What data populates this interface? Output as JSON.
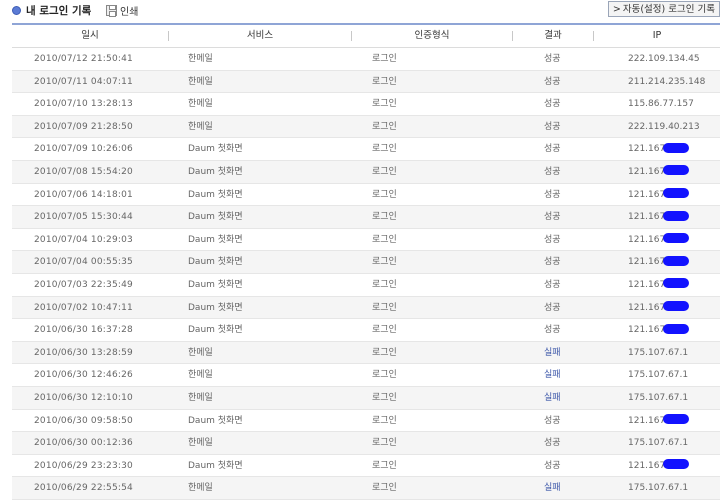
{
  "page": {
    "title": "내 로그인 기록",
    "print_label": "인쇄",
    "auto_login_label": "자동(설정) 로그인 기록"
  },
  "table": {
    "columns": [
      "일시",
      "서비스",
      "인증형식",
      "결과",
      "IP"
    ],
    "rows": [
      {
        "date": "2010/07/12 21:50:41",
        "service": "한메일",
        "auth": "로그인",
        "result": "성공",
        "ip": "222.109.134.45",
        "masked": false
      },
      {
        "date": "2010/07/11 04:07:11",
        "service": "한메일",
        "auth": "로그인",
        "result": "성공",
        "ip": "211.214.235.148",
        "masked": false
      },
      {
        "date": "2010/07/10 13:28:13",
        "service": "한메일",
        "auth": "로그인",
        "result": "성공",
        "ip": "115.86.77.157",
        "masked": false
      },
      {
        "date": "2010/07/09 21:28:50",
        "service": "한메일",
        "auth": "로그인",
        "result": "성공",
        "ip": "222.119.40.213",
        "masked": false
      },
      {
        "date": "2010/07/09 10:26:06",
        "service": "Daum 첫화면",
        "auth": "로그인",
        "result": "성공",
        "ip": "121.167",
        "masked": true
      },
      {
        "date": "2010/07/08 15:54:20",
        "service": "Daum 첫화면",
        "auth": "로그인",
        "result": "성공",
        "ip": "121.167",
        "masked": true
      },
      {
        "date": "2010/07/06 14:18:01",
        "service": "Daum 첫화면",
        "auth": "로그인",
        "result": "성공",
        "ip": "121.167",
        "masked": true
      },
      {
        "date": "2010/07/05 15:30:44",
        "service": "Daum 첫화면",
        "auth": "로그인",
        "result": "성공",
        "ip": "121.167",
        "masked": true
      },
      {
        "date": "2010/07/04 10:29:03",
        "service": "Daum 첫화면",
        "auth": "로그인",
        "result": "성공",
        "ip": "121.167",
        "masked": true
      },
      {
        "date": "2010/07/04 00:55:35",
        "service": "Daum 첫화면",
        "auth": "로그인",
        "result": "성공",
        "ip": "121.167",
        "masked": true
      },
      {
        "date": "2010/07/03 22:35:49",
        "service": "Daum 첫화면",
        "auth": "로그인",
        "result": "성공",
        "ip": "121.167",
        "masked": true
      },
      {
        "date": "2010/07/02 10:47:11",
        "service": "Daum 첫화면",
        "auth": "로그인",
        "result": "성공",
        "ip": "121.167",
        "masked": true
      },
      {
        "date": "2010/06/30 16:37:28",
        "service": "Daum 첫화면",
        "auth": "로그인",
        "result": "성공",
        "ip": "121.167",
        "masked": true
      },
      {
        "date": "2010/06/30 13:28:59",
        "service": "한메일",
        "auth": "로그인",
        "result": "실패",
        "ip": "175.107.67.1",
        "masked": false
      },
      {
        "date": "2010/06/30 12:46:26",
        "service": "한메일",
        "auth": "로그인",
        "result": "실패",
        "ip": "175.107.67.1",
        "masked": false
      },
      {
        "date": "2010/06/30 12:10:10",
        "service": "한메일",
        "auth": "로그인",
        "result": "실패",
        "ip": "175.107.67.1",
        "masked": false
      },
      {
        "date": "2010/06/30 09:58:50",
        "service": "Daum 첫화면",
        "auth": "로그인",
        "result": "성공",
        "ip": "121.167",
        "masked": true
      },
      {
        "date": "2010/06/30 00:12:36",
        "service": "한메일",
        "auth": "로그인",
        "result": "성공",
        "ip": "175.107.67.1",
        "masked": false
      },
      {
        "date": "2010/06/29 23:23:30",
        "service": "Daum 첫화면",
        "auth": "로그인",
        "result": "성공",
        "ip": "121.167",
        "masked": true
      },
      {
        "date": "2010/06/29 22:55:54",
        "service": "한메일",
        "auth": "로그인",
        "result": "실패",
        "ip": "175.107.67.1",
        "masked": false
      }
    ]
  },
  "colors": {
    "accent_line": "#8fa5d6",
    "fail_text": "#3a55a8",
    "mask": "#1212ff"
  },
  "icons": {
    "title": "bullet-dot-icon",
    "print": "printer-icon",
    "auto_login": "chevron-right-icon"
  }
}
